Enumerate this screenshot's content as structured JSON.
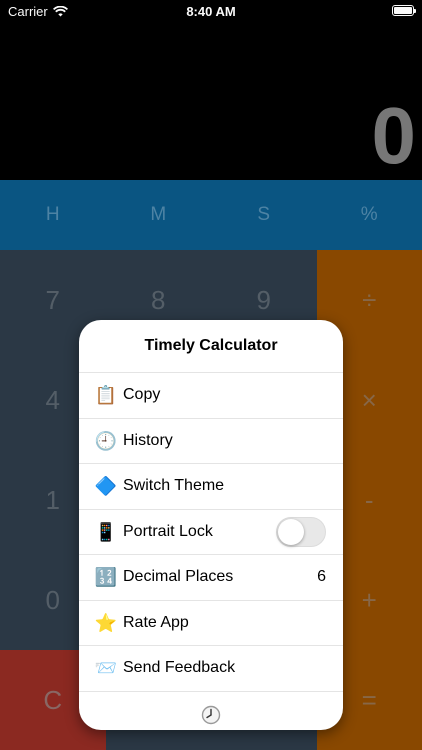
{
  "status_bar": {
    "carrier": "Carrier",
    "time": "8:40 AM",
    "battery_level": 1.0
  },
  "display": {
    "value": "0"
  },
  "unit_row": [
    {
      "label": "H"
    },
    {
      "label": "M"
    },
    {
      "label": "S"
    },
    {
      "label": "%"
    }
  ],
  "keypad": {
    "num_color": "#2c3a47",
    "op_color": "#8c4a00",
    "clear_color": "#8e2a22",
    "keys": [
      {
        "label": "7",
        "kind": "num"
      },
      {
        "label": "8",
        "kind": "num"
      },
      {
        "label": "9",
        "kind": "num"
      },
      {
        "label": "÷",
        "kind": "op"
      },
      {
        "label": "4",
        "kind": "num"
      },
      {
        "label": "",
        "kind": "num"
      },
      {
        "label": "",
        "kind": "num"
      },
      {
        "label": "×",
        "kind": "op"
      },
      {
        "label": "1",
        "kind": "num"
      },
      {
        "label": "",
        "kind": "num"
      },
      {
        "label": "",
        "kind": "num"
      },
      {
        "label": "-",
        "kind": "op"
      },
      {
        "label": "0",
        "kind": "num"
      },
      {
        "label": "",
        "kind": "num"
      },
      {
        "label": "",
        "kind": "num"
      },
      {
        "label": "+",
        "kind": "op"
      },
      {
        "label": "C",
        "kind": "clr"
      },
      {
        "label": "",
        "kind": "num"
      },
      {
        "label": "",
        "kind": "num"
      },
      {
        "label": "=",
        "kind": "op"
      }
    ]
  },
  "menu": {
    "title": "Timely Calculator",
    "items": [
      {
        "name": "copy",
        "label": "Copy",
        "icon": "clipboard-icon",
        "glyph": "📋"
      },
      {
        "name": "history",
        "label": "History",
        "icon": "clock-icon",
        "glyph": "🕘"
      },
      {
        "name": "switch-theme",
        "label": "Switch Theme",
        "icon": "blue-diamond-icon",
        "glyph": "🔷"
      },
      {
        "name": "portrait-lock",
        "label": "Portrait Lock",
        "icon": "phone-icon",
        "glyph": "📱",
        "toggle": false
      },
      {
        "name": "decimal-places",
        "label": "Decimal Places",
        "icon": "numbers-icon",
        "glyph": "🔢",
        "value": "6"
      },
      {
        "name": "rate-app",
        "label": "Rate App",
        "icon": "star-icon",
        "glyph": "⭐"
      },
      {
        "name": "send-feedback",
        "label": "Send Feedback",
        "icon": "envelope-icon",
        "glyph": "📨"
      }
    ],
    "footer_icon": "clock-icon"
  }
}
